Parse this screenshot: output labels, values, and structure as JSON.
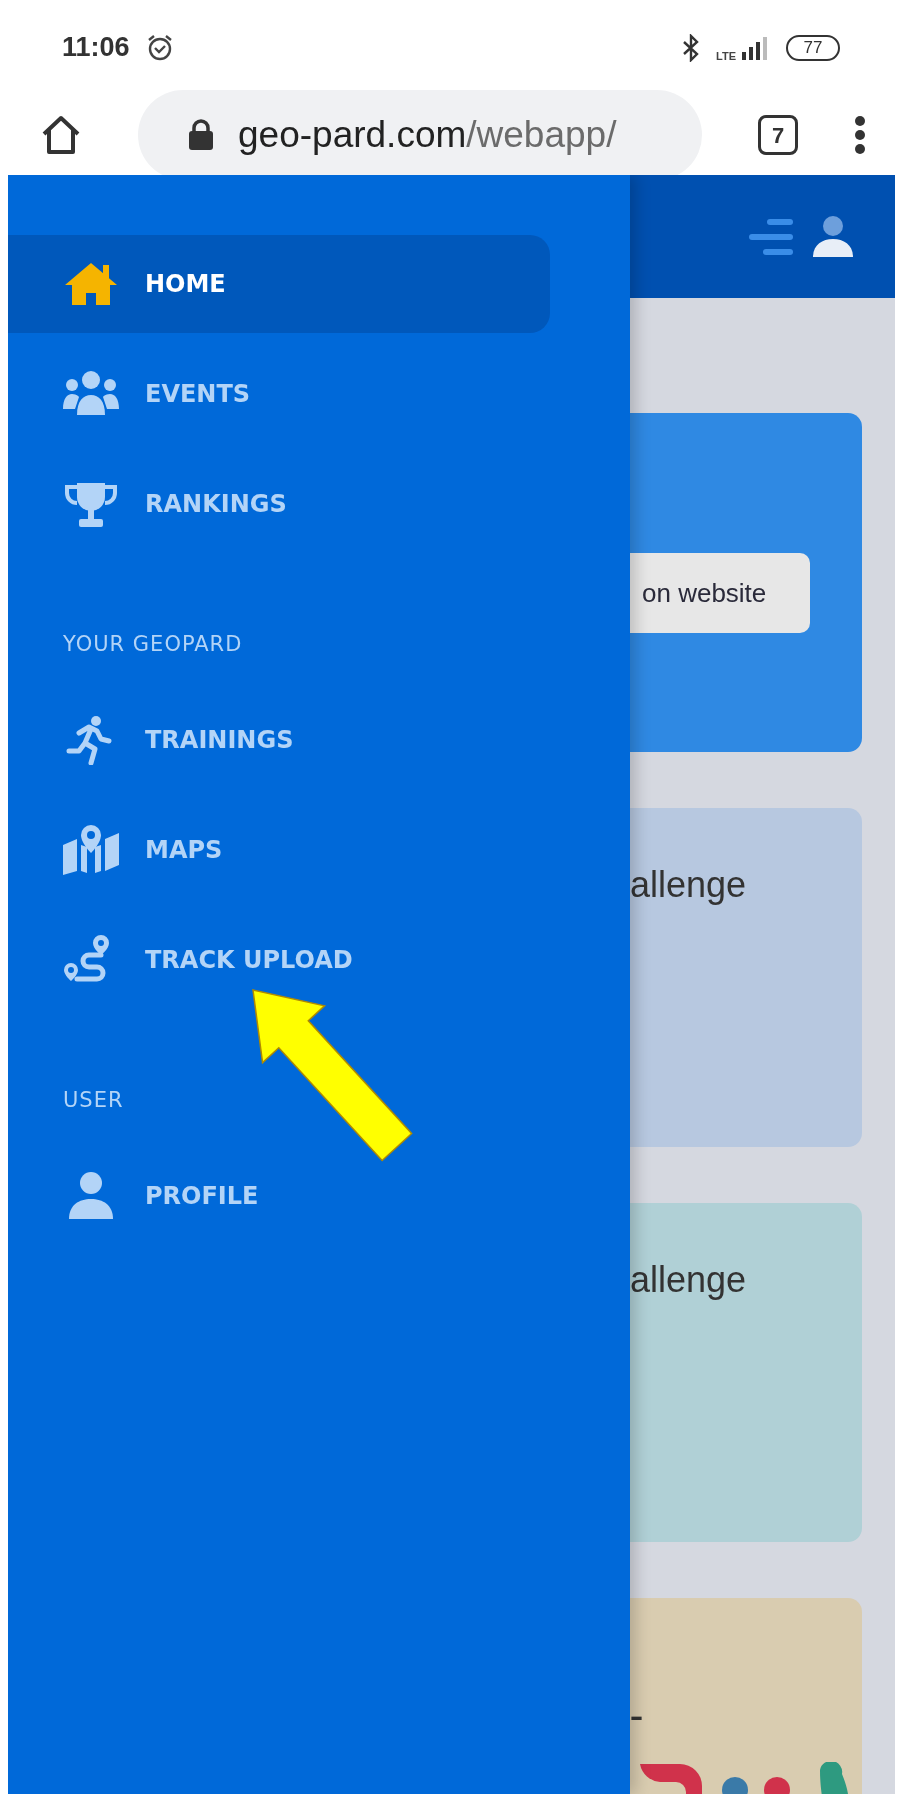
{
  "status_bar": {
    "time": "11:06",
    "network": "LTE",
    "battery": "77"
  },
  "browser": {
    "url_host": "geo-pard.com",
    "url_path": "/webapp/",
    "tab_count": "7"
  },
  "drawer": {
    "items": [
      {
        "kind": "link",
        "label": "HOME",
        "selected": true
      },
      {
        "kind": "link",
        "label": "EVENTS",
        "selected": false
      },
      {
        "kind": "link",
        "label": "RANKINGS",
        "selected": false
      },
      {
        "kind": "heading",
        "label": "YOUR GEOPARD"
      },
      {
        "kind": "link",
        "label": "TRAININGS",
        "selected": false
      },
      {
        "kind": "link",
        "label": "MAPS",
        "selected": false
      },
      {
        "kind": "link",
        "label": "TRACK UPLOAD",
        "selected": false
      },
      {
        "kind": "heading",
        "label": "USER"
      },
      {
        "kind": "link",
        "label": "PROFILE",
        "selected": false
      }
    ]
  },
  "content": {
    "cards": [
      {
        "kind": "button",
        "text": "on website",
        "color": "#2f89e3"
      },
      {
        "kind": "title",
        "text": "allenge",
        "color": "#b7c8e0"
      },
      {
        "kind": "title",
        "text": "allenge",
        "color": "#b0d0d6"
      },
      {
        "kind": "logo",
        "text": "–",
        "color": "#d9ccb0"
      }
    ]
  }
}
